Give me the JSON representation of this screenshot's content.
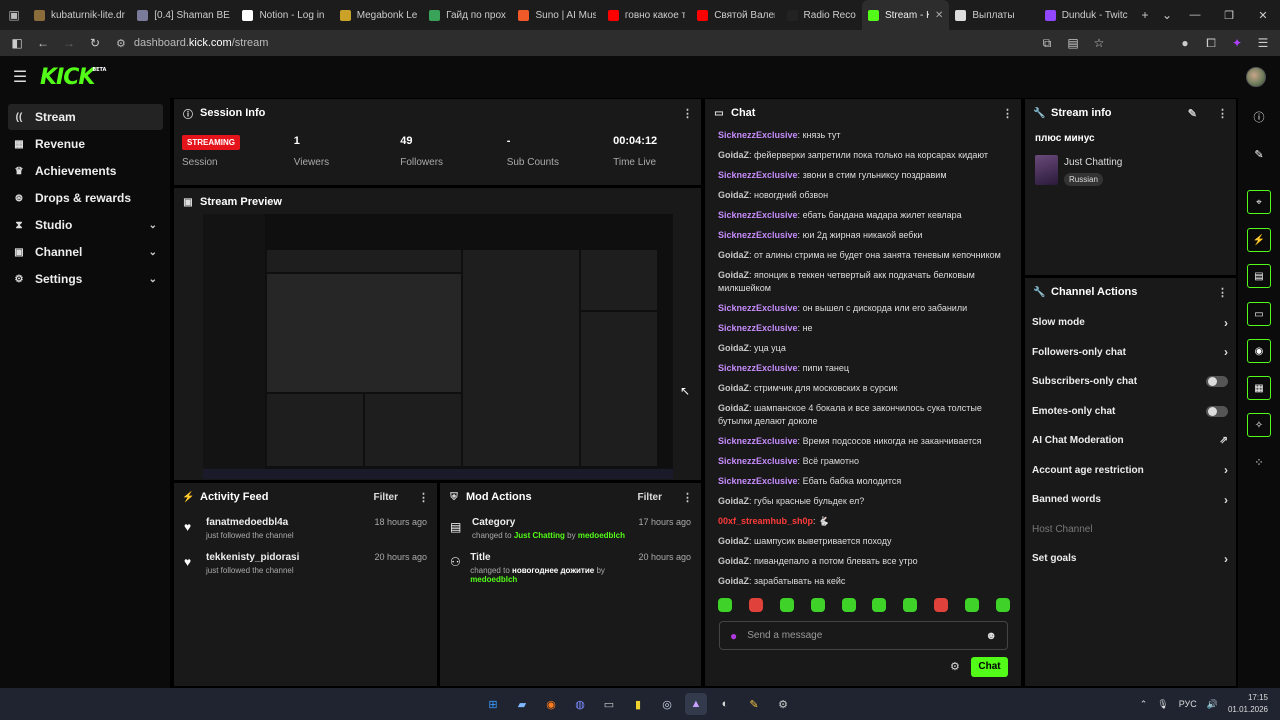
{
  "browser": {
    "tabs": [
      {
        "label": "kubaturnik-lite.dr",
        "color": "#8a6d3b"
      },
      {
        "label": "[0.4] Shaman BEA",
        "color": "#7a7a9a"
      },
      {
        "label": "Notion - Log in",
        "color": "#ffffff"
      },
      {
        "label": "Megabonk Leade",
        "color": "#c9a227"
      },
      {
        "label": "Гайд по прохож",
        "color": "#3aa35a"
      },
      {
        "label": "Suno | AI Music",
        "color": "#f05a28"
      },
      {
        "label": "говно какое то н",
        "color": "#ff0000"
      },
      {
        "label": "Святой Валентин",
        "color": "#ff0000"
      },
      {
        "label": "Radio Record",
        "color": "#222222"
      },
      {
        "label": "Stream - K",
        "color": "#53fc18"
      },
      {
        "label": "Выплаты",
        "color": "#dddddd"
      },
      {
        "label": "Dunduk - Twitch",
        "color": "#9146ff"
      }
    ],
    "active_tab": "Stream - K",
    "url_prefix": "dashboard.",
    "url_domain": "kick.com",
    "url_path": "/stream"
  },
  "kick": {
    "logo": "KICK",
    "logo_badge": "BETA"
  },
  "sidebar": {
    "items": [
      {
        "label": "Stream",
        "icon": "broadcast-icon"
      },
      {
        "label": "Revenue",
        "icon": "revenue-icon"
      },
      {
        "label": "Achievements",
        "icon": "trophy-icon"
      },
      {
        "label": "Drops & rewards",
        "icon": "gift-icon"
      },
      {
        "label": "Studio",
        "icon": "studio-icon"
      },
      {
        "label": "Channel",
        "icon": "channel-icon"
      },
      {
        "label": "Settings",
        "icon": "gear-icon"
      }
    ]
  },
  "session": {
    "title": "Session Info",
    "status": "STREAMING",
    "stats": [
      {
        "value": "",
        "label": "Session"
      },
      {
        "value": "1",
        "label": "Viewers"
      },
      {
        "value": "49",
        "label": "Followers"
      },
      {
        "value": "-",
        "label": "Sub Counts"
      },
      {
        "value": "00:04:12",
        "label": "Time Live"
      }
    ]
  },
  "preview": {
    "title": "Stream Preview"
  },
  "activity": {
    "title": "Activity Feed",
    "filter": "Filter",
    "items": [
      {
        "name": "fanatmedoedbl4a",
        "sub": "just followed the channel",
        "time": "18 hours ago"
      },
      {
        "name": "tekkenisty_pidorasi",
        "sub": "just followed the channel",
        "time": "20 hours ago"
      }
    ]
  },
  "mod": {
    "title": "Mod Actions",
    "filter": "Filter",
    "items": [
      {
        "name": "Category",
        "pre": "changed to",
        "value": "Just Chatting",
        "by": "by",
        "user": "medoedblch",
        "time": "17 hours ago"
      },
      {
        "name": "Title",
        "pre": "changed to",
        "value": "новогоднее дожитие",
        "by": "by",
        "user": "medoedblch",
        "time": "20 hours ago"
      }
    ]
  },
  "chat": {
    "title": "Chat",
    "messages": [
      {
        "user": "SicknezzExclusive",
        "text": "князь тут",
        "c": "s"
      },
      {
        "user": "GoidaZ",
        "text": "фейерверки запретили пока только на корсарах кидают",
        "c": "g"
      },
      {
        "user": "SicknezzExclusive",
        "text": "звони в стим гульниксу поздравим",
        "c": "s"
      },
      {
        "user": "GoidaZ",
        "text": "новогдний обзвон",
        "c": "g"
      },
      {
        "user": "SicknezzExclusive",
        "text": "ебать бандана мадара жилет кевлара",
        "c": "s"
      },
      {
        "user": "SicknezzExclusive",
        "text": "юи 2д жирная никакой вебки",
        "c": "s"
      },
      {
        "user": "GoidaZ",
        "text": "от алины стрима не будет она занята теневым кепочником",
        "c": "g"
      },
      {
        "user": "GoidaZ",
        "text": "японцик в теккен четвертый акк подкачать белковым милкшейком",
        "c": "g"
      },
      {
        "user": "SicknezzExclusive",
        "text": "он вышел с дискорда или его забанили",
        "c": "s"
      },
      {
        "user": "SicknezzExclusive",
        "text": "не",
        "c": "s"
      },
      {
        "user": "GoidaZ",
        "text": "уца уца",
        "c": "g"
      },
      {
        "user": "SicknezzExclusive",
        "text": "пипи танец",
        "c": "s"
      },
      {
        "user": "GoidaZ",
        "text": "стримчик для московских в сурсик",
        "c": "g"
      },
      {
        "user": "GoidaZ",
        "text": "шампанское 4 бокала и все закончилось сука толстые бутылки делают доколе",
        "c": "g"
      },
      {
        "user": "SicknezzExclusive",
        "text": "Время подсосов никогда не заканчивается",
        "c": "s"
      },
      {
        "user": "SicknezzExclusive",
        "text": "Всё грамотно",
        "c": "s"
      },
      {
        "user": "SicknezzExclusive",
        "text": "Ебать бабка молодится",
        "c": "s"
      },
      {
        "user": "GoidaZ",
        "text": "губы красные бульдек ел?",
        "c": "g"
      },
      {
        "user": "00xf_streamhub_sh0p",
        "text": "🐇",
        "c": "r"
      },
      {
        "user": "GoidaZ",
        "text": "шампусик выветривается походу",
        "c": "g"
      },
      {
        "user": "GoidaZ",
        "text": "пивандепало а потом блевать все утро",
        "c": "g"
      },
      {
        "user": "GoidaZ",
        "text": "зарабатывать на кейс",
        "c": "g"
      }
    ],
    "input_placeholder": "Send a message",
    "send_label": "Chat"
  },
  "stream_info": {
    "title": "Stream info",
    "stream_title": "плюс минус",
    "category": "Just Chatting",
    "language": "Russian"
  },
  "channel_actions": {
    "title": "Channel Actions",
    "items": [
      {
        "label": "Slow mode",
        "kind": "arrow"
      },
      {
        "label": "Followers-only chat",
        "kind": "arrow"
      },
      {
        "label": "Subscribers-only chat",
        "kind": "toggle"
      },
      {
        "label": "Emotes-only chat",
        "kind": "toggle"
      },
      {
        "label": "AI Chat Moderation",
        "kind": "ext"
      },
      {
        "label": "Account age restriction",
        "kind": "arrow"
      },
      {
        "label": "Banned words",
        "kind": "arrow"
      },
      {
        "label": "Host Channel",
        "kind": "dim"
      },
      {
        "label": "Set goals",
        "kind": "arrow"
      }
    ]
  },
  "taskbar": {
    "lang": "РУС",
    "time": "17:15",
    "date": "01.01.2026"
  },
  "colors": {
    "accent": "#53fc18",
    "live": "#e5141b",
    "panel": "#191919"
  }
}
